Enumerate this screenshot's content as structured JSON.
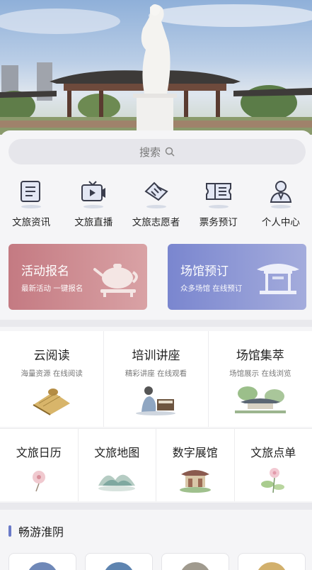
{
  "search": {
    "placeholder": "搜索"
  },
  "quick_entries": [
    {
      "label": "文旅资讯",
      "icon": "news-icon"
    },
    {
      "label": "文旅直播",
      "icon": "live-tv-icon"
    },
    {
      "label": "文旅志愿者",
      "icon": "handshake-icon"
    },
    {
      "label": "票务预订",
      "icon": "ticket-icon"
    },
    {
      "label": "个人中心",
      "icon": "user-icon"
    }
  ],
  "promos": [
    {
      "title": "活动报名",
      "subtitle": "最新活动 一键报名",
      "color": "#c98890"
    },
    {
      "title": "场馆预订",
      "subtitle": "众多场馆 在线预订",
      "color": "#8a95d4"
    }
  ],
  "features_top": [
    {
      "title": "云阅读",
      "subtitle": "海量资源 在线阅读"
    },
    {
      "title": "培训讲座",
      "subtitle": "精彩讲座 在线观看"
    },
    {
      "title": "场馆集萃",
      "subtitle": "场馆展示 在线浏览"
    }
  ],
  "features_bottom": [
    {
      "title": "文旅日历"
    },
    {
      "title": "文旅地图"
    },
    {
      "title": "数字展馆"
    },
    {
      "title": "文旅点单"
    }
  ],
  "section": {
    "title": "畅游淮阴"
  },
  "colors": {
    "accent": "#6a7ac8",
    "background": "#f5f5f7"
  }
}
